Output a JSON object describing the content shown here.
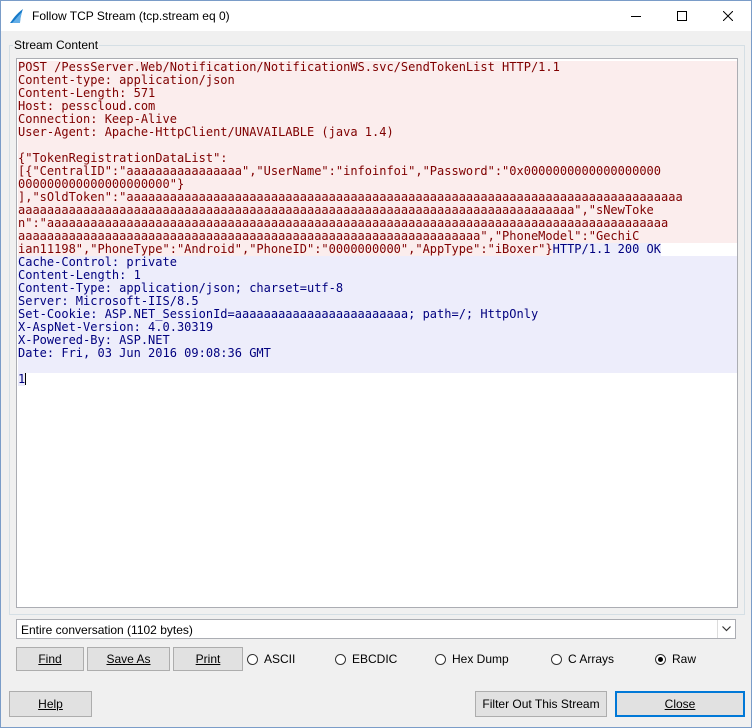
{
  "window": {
    "title": "Follow TCP Stream (tcp.stream eq 0)"
  },
  "group": {
    "label": "Stream Content"
  },
  "stream": {
    "client_request_lines": [
      "POST /PessServer.Web/Notification/NotificationWS.svc/SendTokenList HTTP/1.1",
      "Content-type: application/json",
      "Content-Length: 571",
      "Host: pesscloud.com",
      "Connection: Keep-Alive",
      "User-Agent: Apache-HttpClient/UNAVAILABLE (java 1.4)",
      "",
      "{\"TokenRegistrationDataList\":",
      "[{\"CentralID\":\"aaaaaaaaaaaaaaaa\",\"UserName\":\"infoinfoi\",\"Password\":\"0x0000000000000000000",
      "000000000000000000000\"}",
      "],\"sOldToken\":\"aaaaaaaaaaaaaaaaaaaaaaaaaaaaaaaaaaaaaaaaaaaaaaaaaaaaaaaaaaaaaaaaaaaaaaaaaaaaa",
      "aaaaaaaaaaaaaaaaaaaaaaaaaaaaaaaaaaaaaaaaaaaaaaaaaaaaaaaaaaaaaaaaaaaaaaaaaaaaa\",\"sNewToke",
      "n\":\"aaaaaaaaaaaaaaaaaaaaaaaaaaaaaaaaaaaaaaaaaaaaaaaaaaaaaaaaaaaaaaaaaaaaaaaaaaaaaaaaaaaaaa",
      "aaaaaaaaaaaaaaaaaaaaaaaaaaaaaaaaaaaaaaaaaaaaaaaaaaaaaaaaaaaaaaaa\",\"PhoneModel\":\"GechiC"
    ],
    "mixed_line_client": "ian11198\",\"PhoneType\":\"Android\",\"PhoneID\":\"0000000000\",\"AppType\":\"iBoxer\"}",
    "mixed_line_server": "HTTP/1.1 200 OK",
    "server_response_lines": [
      "Cache-Control: private",
      "Content-Length: 1",
      "Content-Type: application/json; charset=utf-8",
      "Server: Microsoft-IIS/8.5",
      "Set-Cookie: ASP.NET_SessionId=aaaaaaaaaaaaaaaaaaaaaaaa; path=/; HttpOnly",
      "X-AspNet-Version: 4.0.30319",
      "X-Powered-By: ASP.NET",
      "Date: Fri, 03 Jun 2016 09:08:36 GMT",
      ""
    ],
    "body_line": "1"
  },
  "conversation": {
    "selected": "Entire conversation (1102 bytes)"
  },
  "buttons": {
    "find": "Find",
    "save_as": "Save As",
    "print": "Print",
    "help": "Help",
    "filter_out": "Filter Out This Stream",
    "close": "Close"
  },
  "format_options": [
    {
      "label": "ASCII",
      "checked": false
    },
    {
      "label": "EBCDIC",
      "checked": false
    },
    {
      "label": "Hex Dump",
      "checked": false
    },
    {
      "label": "C Arrays",
      "checked": false
    },
    {
      "label": "Raw",
      "checked": true
    }
  ],
  "colors": {
    "client_fg": "#7f0000",
    "client_bg": "#fbeded",
    "server_fg": "#00007f",
    "server_bg": "#ededfb",
    "accent": "#0078d7"
  },
  "icons": {
    "app": "wireshark-fin-icon",
    "minimize": "minimize-icon",
    "maximize": "maximize-icon",
    "close": "close-icon",
    "dropdown": "chevron-down-icon"
  }
}
